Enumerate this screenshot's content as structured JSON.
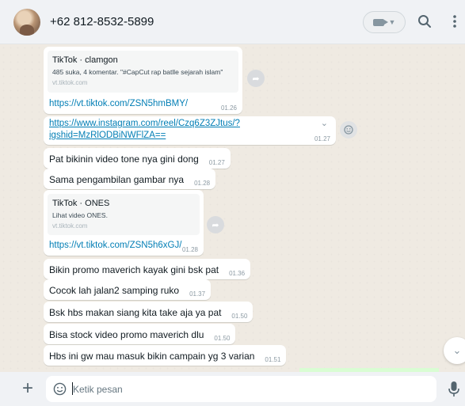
{
  "header": {
    "contact_name": "+62 812-8532-5899"
  },
  "messages": {
    "m1": {
      "preview_title": "TikTok · clamgon",
      "preview_desc": "485 suka, 4 komentar. \"#CapCut rap batlle sejarah islam\"",
      "preview_domain": "vt.tiktok.com",
      "link": "https://vt.tiktok.com/ZSN5hmBMY/",
      "time": "01.26"
    },
    "m2": {
      "link_line1": "https://www.instagram.com/reel/Czq6Z3ZJtus/?",
      "link_line2": "igshid=MzRlODBiNWFlZA==",
      "time": "01.27"
    },
    "m3": {
      "text": "Pat bikinin video tone nya gini dong",
      "time": "01.27"
    },
    "m4": {
      "text": "Sama pengambilan gambar nya",
      "time": "01.28"
    },
    "m5": {
      "preview_title": "TikTok · ONES",
      "preview_desc": "Lihat video ONES.",
      "preview_domain": "vt.tiktok.com",
      "link": "https://vt.tiktok.com/ZSN5h6xGJ/",
      "time": "01.28"
    },
    "m6": {
      "text": "Bikin promo maverich kayak gini bsk pat",
      "time": "01.36"
    },
    "m7": {
      "text": "Cocok lah jalan2 samping ruko",
      "time": "01.37"
    },
    "m8": {
      "text": "Bsk hbs makan siang kita take aja ya pat",
      "time": "01.50"
    },
    "m9": {
      "text": "Bisa stock video promo maverich dlu",
      "time": "01.50"
    },
    "m10": {
      "text": "Hbs ini gw mau masuk bikin campain yg 3 varian",
      "time": "01.51"
    }
  },
  "composer": {
    "placeholder": "Ketik pesan"
  },
  "icons": {
    "video": "video-call-icon",
    "search": "search-icon",
    "menu": "menu-icon",
    "forward": "forward-icon",
    "reaction": "emoji-reaction-icon",
    "scroll": "chevron-down-icon",
    "attach": "plus-icon",
    "emoji": "emoji-icon",
    "mic": "microphone-icon"
  },
  "colors": {
    "link": "#027eb5",
    "chat_bg": "#efeae2",
    "panel_bg": "#f0f2f5"
  }
}
